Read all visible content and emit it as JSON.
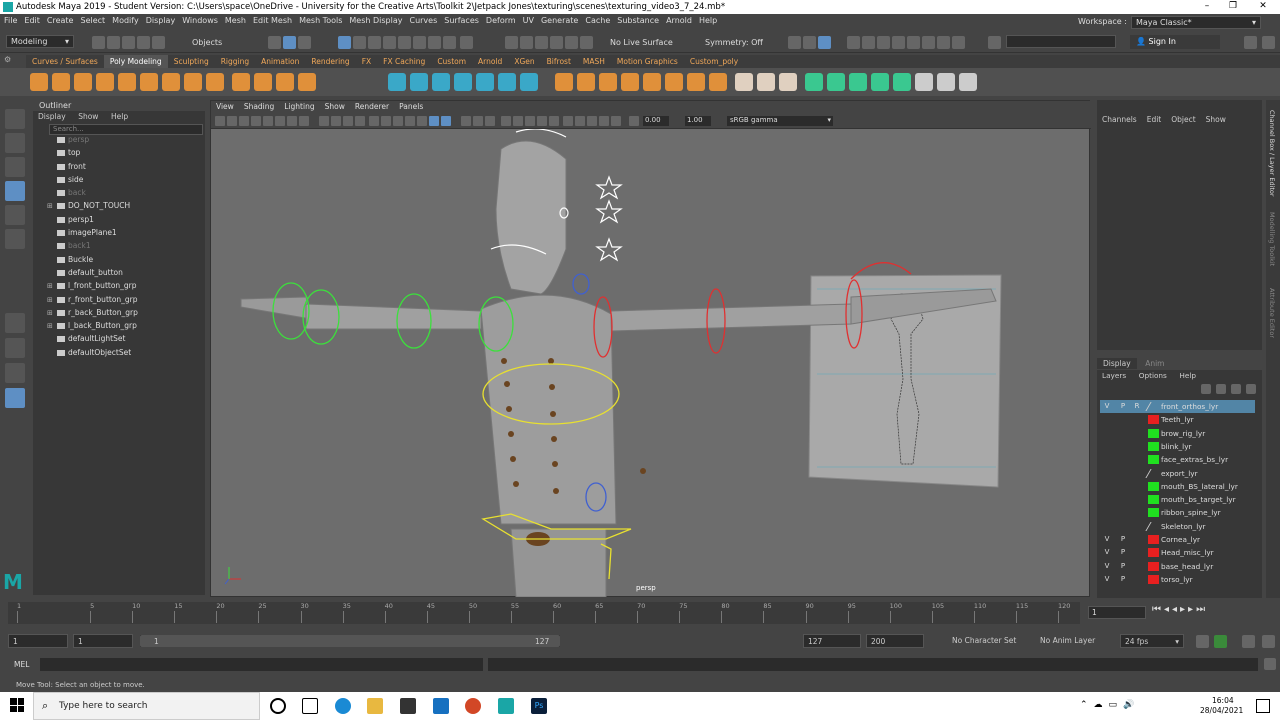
{
  "window": {
    "title": "Autodesk Maya 2019 - Student Version: C:\\Users\\space\\OneDrive - University for the Creative Arts\\Toolkit 2\\Jetpack Jones\\texturing\\scenes\\texturing_video3_7_24.mb*",
    "min": "–",
    "max": "❐",
    "close": "✕"
  },
  "menus": [
    "File",
    "Edit",
    "Create",
    "Select",
    "Modify",
    "Display",
    "Windows",
    "Mesh",
    "Edit Mesh",
    "Mesh Tools",
    "Mesh Display",
    "Curves",
    "Surfaces",
    "Deform",
    "UV",
    "Generate",
    "Cache",
    "Substance",
    "Arnold",
    "Help"
  ],
  "workspace": {
    "label": "Workspace :",
    "value": "Maya Classic*"
  },
  "status": {
    "mode": "Modeling",
    "objects": "Objects",
    "live_surface": "No Live Surface",
    "symmetry": "Symmetry: Off",
    "sign_in": "Sign In"
  },
  "shelf_tabs": [
    "Curves / Surfaces",
    "Poly Modeling",
    "Sculpting",
    "Rigging",
    "Animation",
    "Rendering",
    "FX",
    "FX Caching",
    "Custom",
    "Arnold",
    "XGen",
    "Bifrost",
    "MASH",
    "Motion Graphics",
    "Custom_poly"
  ],
  "shelf_active": "Poly Modeling",
  "outliner": {
    "title": "Outliner",
    "menu": [
      "Display",
      "Show",
      "Help"
    ],
    "search_placeholder": "Search...",
    "items": [
      {
        "label": "persp",
        "dim": true,
        "exp": false
      },
      {
        "label": "top",
        "dim": false,
        "exp": false
      },
      {
        "label": "front",
        "dim": false,
        "exp": false
      },
      {
        "label": "side",
        "dim": false,
        "exp": false
      },
      {
        "label": "back",
        "dim": true,
        "exp": false
      },
      {
        "label": "DO_NOT_TOUCH",
        "dim": false,
        "exp": true
      },
      {
        "label": "persp1",
        "dim": false,
        "exp": false
      },
      {
        "label": "imagePlane1",
        "dim": false,
        "exp": false
      },
      {
        "label": "back1",
        "dim": true,
        "exp": false
      },
      {
        "label": "Buckle",
        "dim": false,
        "exp": false
      },
      {
        "label": "default_button",
        "dim": false,
        "exp": false
      },
      {
        "label": "l_front_button_grp",
        "dim": false,
        "exp": true
      },
      {
        "label": "r_front_button_grp",
        "dim": false,
        "exp": true
      },
      {
        "label": "r_back_Button_grp",
        "dim": false,
        "exp": true
      },
      {
        "label": "l_back_Button_grp",
        "dim": false,
        "exp": true
      },
      {
        "label": "defaultLightSet",
        "dim": false,
        "exp": false
      },
      {
        "label": "defaultObjectSet",
        "dim": false,
        "exp": false
      }
    ]
  },
  "viewport": {
    "menu": [
      "View",
      "Shading",
      "Lighting",
      "Show",
      "Renderer",
      "Panels"
    ],
    "exposure": "0.00",
    "gamma": "1.00",
    "colorspace": "sRGB gamma",
    "camera_label": "persp"
  },
  "channel_box": {
    "menu": [
      "Channels",
      "Edit",
      "Object",
      "Show"
    ]
  },
  "side_tabs": [
    "Channel Box / Layer Editor",
    "Modelling Toolkit",
    "Attribute Editor"
  ],
  "layer_editor": {
    "tabs": [
      "Display",
      "Anim"
    ],
    "menu": [
      "Layers",
      "Options",
      "Help"
    ],
    "header": {
      "v": "V",
      "p": "P",
      "r": "R"
    },
    "layers": [
      {
        "name": "front_orthos_lyr",
        "color": "none",
        "v": "",
        "p": "",
        "selected": true
      },
      {
        "name": "Teeth_lyr",
        "color": "#e82020",
        "v": "",
        "p": "",
        "selected": false
      },
      {
        "name": "brow_rig_lyr",
        "color": "#20e020",
        "v": "",
        "p": "",
        "selected": false
      },
      {
        "name": "blink_lyr",
        "color": "#20e020",
        "v": "",
        "p": "",
        "selected": false
      },
      {
        "name": "face_extras_bs_lyr",
        "color": "#20e020",
        "v": "",
        "p": "",
        "selected": false
      },
      {
        "name": "export_lyr",
        "color": "none",
        "v": "",
        "p": "",
        "selected": false
      },
      {
        "name": "mouth_BS_lateral_lyr",
        "color": "#20e020",
        "v": "",
        "p": "",
        "selected": false
      },
      {
        "name": "mouth_bs_target_lyr",
        "color": "#20e020",
        "v": "",
        "p": "",
        "selected": false
      },
      {
        "name": "ribbon_spine_lyr",
        "color": "#20e020",
        "v": "",
        "p": "",
        "selected": false
      },
      {
        "name": "Skeleton_lyr",
        "color": "none",
        "v": "",
        "p": "",
        "selected": false
      },
      {
        "name": "Cornea_lyr",
        "color": "#e82020",
        "v": "V",
        "p": "P",
        "selected": false
      },
      {
        "name": "Head_misc_lyr",
        "color": "#e82020",
        "v": "V",
        "p": "P",
        "selected": false
      },
      {
        "name": "base_head_lyr",
        "color": "#e82020",
        "v": "V",
        "p": "P",
        "selected": false
      },
      {
        "name": "torso_lyr",
        "color": "#e82020",
        "v": "V",
        "p": "P",
        "selected": false
      }
    ]
  },
  "timeline": {
    "ticks": [
      "1",
      "5",
      "10",
      "15",
      "20",
      "25",
      "30",
      "35",
      "40",
      "45",
      "50",
      "55",
      "60",
      "65",
      "70",
      "75",
      "80",
      "85",
      "90",
      "95",
      "100",
      "105",
      "110",
      "115",
      "120"
    ],
    "current_frame": "1"
  },
  "range": {
    "start": "1",
    "playback_start": "1",
    "slider_start": "1",
    "slider_end": "127",
    "playback_end": "127",
    "end": "200",
    "character_set": "No Character Set",
    "anim_layer": "No Anim Layer",
    "fps": "24 fps"
  },
  "mel": {
    "label": "MEL"
  },
  "help_line": "Move Tool: Select an object to move.",
  "taskbar": {
    "search_placeholder": "Type here to search",
    "time": "16:04",
    "date": "28/04/2021"
  }
}
